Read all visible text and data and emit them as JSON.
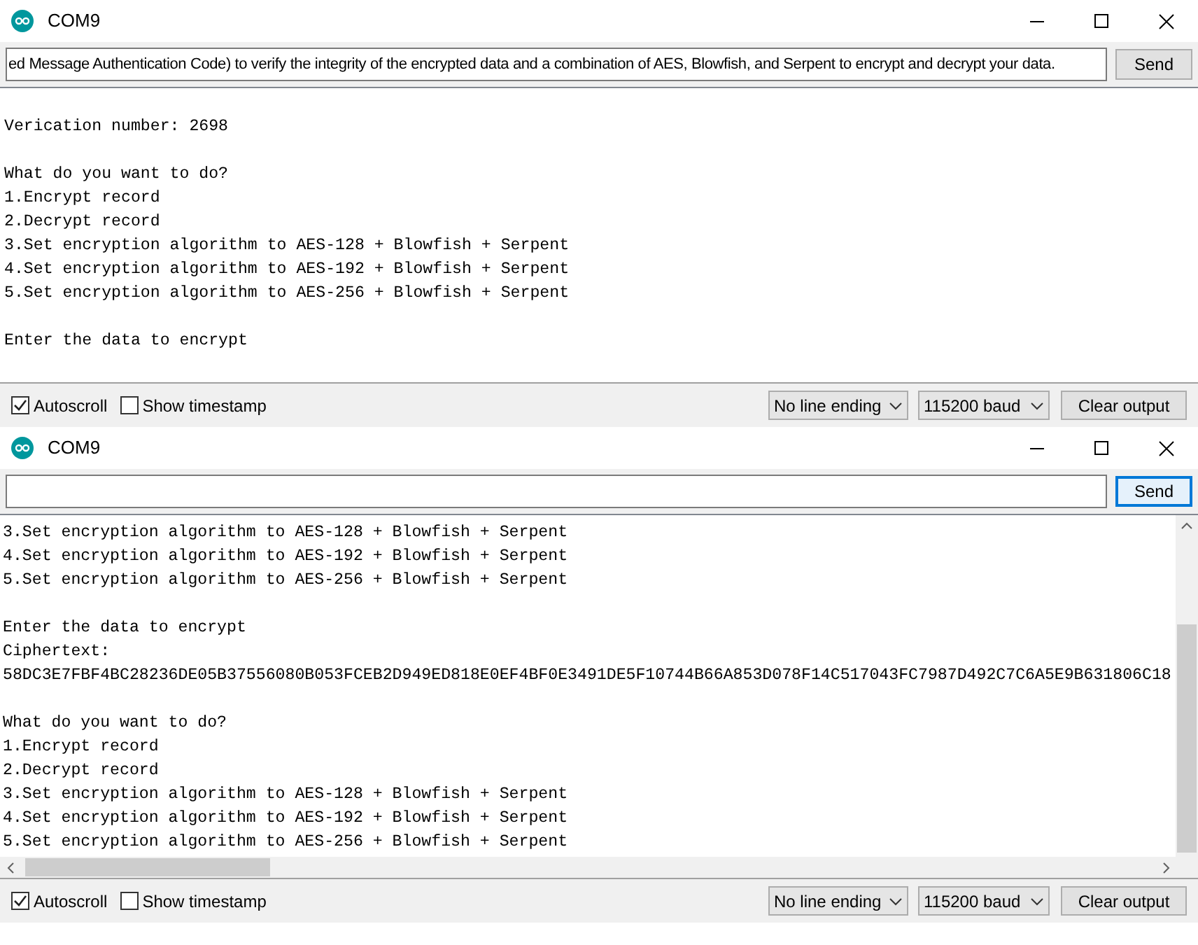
{
  "windows": [
    {
      "title": "COM9",
      "input": {
        "value": "ed Message Authentication Code) to verify the integrity of the encrypted data and a combination of AES, Blowfish, and Serpent to encrypt and decrypt your data."
      },
      "send": {
        "label": "Send",
        "focused": false
      },
      "scrollbars": false,
      "output": [
        [
          "Verication number: 2698"
        ],
        [
          "What do you want to do?",
          "1.Encrypt record",
          "2.Decrypt record",
          "3.Set encryption algorithm to AES-128 + Blowfish + Serpent",
          "4.Set encryption algorithm to AES-192 + Blowfish + Serpent",
          "5.Set encryption algorithm to AES-256 + Blowfish + Serpent"
        ],
        [
          "Enter the data to encrypt"
        ]
      ],
      "autoscroll": {
        "label": "Autoscroll",
        "checked": true
      },
      "timestamp": {
        "label": "Show timestamp",
        "checked": false
      },
      "line_ending": "No line ending",
      "baud": "115200 baud",
      "clear": "Clear output"
    },
    {
      "title": "COM9",
      "send": {
        "label": "Send",
        "focused": true
      },
      "scrollbars": true,
      "output": [
        [
          "3.Set encryption algorithm to AES-128 + Blowfish + Serpent",
          "4.Set encryption algorithm to AES-192 + Blowfish + Serpent",
          "5.Set encryption algorithm to AES-256 + Blowfish + Serpent"
        ],
        [
          "Enter the data to encrypt",
          "Ciphertext:",
          "58DC3E7FBF4BC28236DE05B37556080B053FCEB2D949ED818E0EF4BF0E3491DE5F10744B66A853D078F14C517043FC7987D492C7C6A5E9B631806C18"
        ],
        [
          "What do you want to do?",
          "1.Encrypt record",
          "2.Decrypt record",
          "3.Set encryption algorithm to AES-128 + Blowfish + Serpent",
          "4.Set encryption algorithm to AES-192 + Blowfish + Serpent",
          "5.Set encryption algorithm to AES-256 + Blowfish + Serpent"
        ]
      ],
      "autoscroll": {
        "label": "Autoscroll",
        "checked": true
      },
      "timestamp": {
        "label": "Show timestamp",
        "checked": false
      },
      "line_ending": "No line ending",
      "baud": "115200 baud",
      "clear": "Clear output"
    }
  ]
}
